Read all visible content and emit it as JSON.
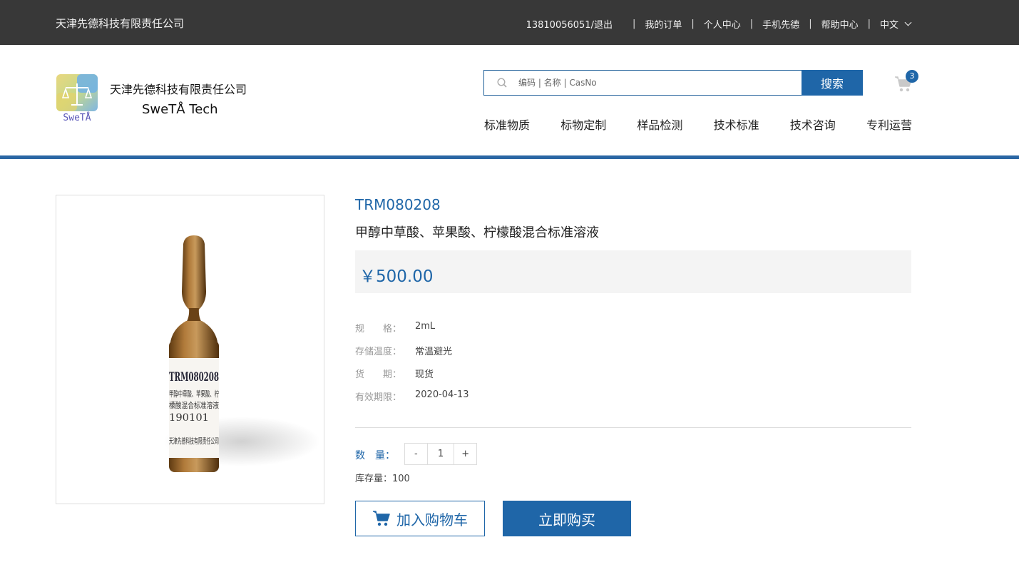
{
  "topbar": {
    "company": "天津先德科技有限责任公司",
    "links": [
      "13810056051/退出",
      "我的订单",
      "个人中心",
      "手机先德",
      "帮助中心"
    ],
    "language": "中文"
  },
  "header": {
    "logo_text": "SweTÅ",
    "brand_cn": "天津先德科技有限责任公司",
    "brand_en": "SweTÅ Tech",
    "search_placeholder": "编码 | 名称 | CasNo",
    "search_button": "搜索",
    "cart_count": "3",
    "nav": [
      "标准物质",
      "标物定制",
      "样品检测",
      "技术标准",
      "技术咨询",
      "专利运营"
    ]
  },
  "product": {
    "image_label": {
      "line1": "TRM080208",
      "line2": "甲醇中草酸、苹果酸、柠",
      "line3": "檬酸混合标准溶液",
      "line4": "190101",
      "line5": "天津先德科技有限责任公司"
    },
    "code": "TRM080208",
    "name": "甲醇中草酸、苹果酸、柠檬酸混合标准溶液",
    "price": "￥500.00",
    "specs": [
      {
        "label": "规　　格：",
        "value": "2mL"
      },
      {
        "label": "存储温度：",
        "value": "常温避光"
      },
      {
        "label": "货　　期：",
        "value": "现货"
      },
      {
        "label": "有效期限：",
        "value": "2020-04-13"
      }
    ],
    "qty_label": "数　量：",
    "qty_minus": "-",
    "qty_value": "1",
    "qty_plus": "+",
    "stock": "库存量：100",
    "add_to_cart": "加入购物车",
    "buy_now": "立即购买"
  },
  "colors": {
    "accent": "#1f66a8",
    "topbar_bg": "#383838"
  }
}
